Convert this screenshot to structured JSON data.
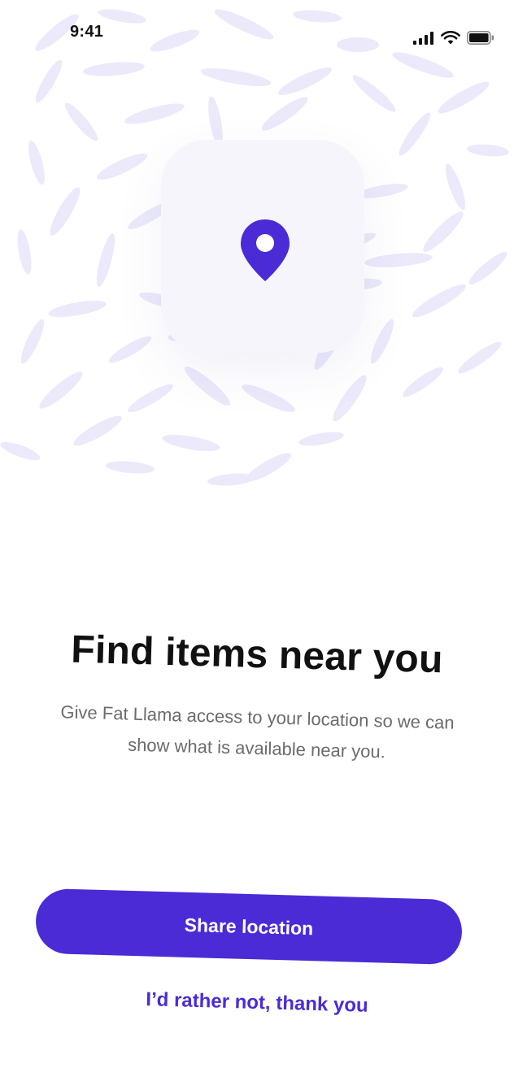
{
  "status_bar": {
    "time": "9:41",
    "icons": [
      "cellular-signal-icon",
      "wifi-icon",
      "battery-icon"
    ]
  },
  "hero": {
    "icon": "location-pin-icon",
    "pattern": "decorative-petal-pattern"
  },
  "content": {
    "title": "Find items near you",
    "description": "Give Fat Llama access to your location so we can show what is available near you."
  },
  "actions": {
    "primary_label": "Share location",
    "secondary_label": "I’d rather not, thank you"
  },
  "colors": {
    "accent": "#4a2bd6",
    "pattern": "#ebe9fa",
    "title": "#111111",
    "description": "#6b6b6b",
    "background": "#ffffff"
  }
}
